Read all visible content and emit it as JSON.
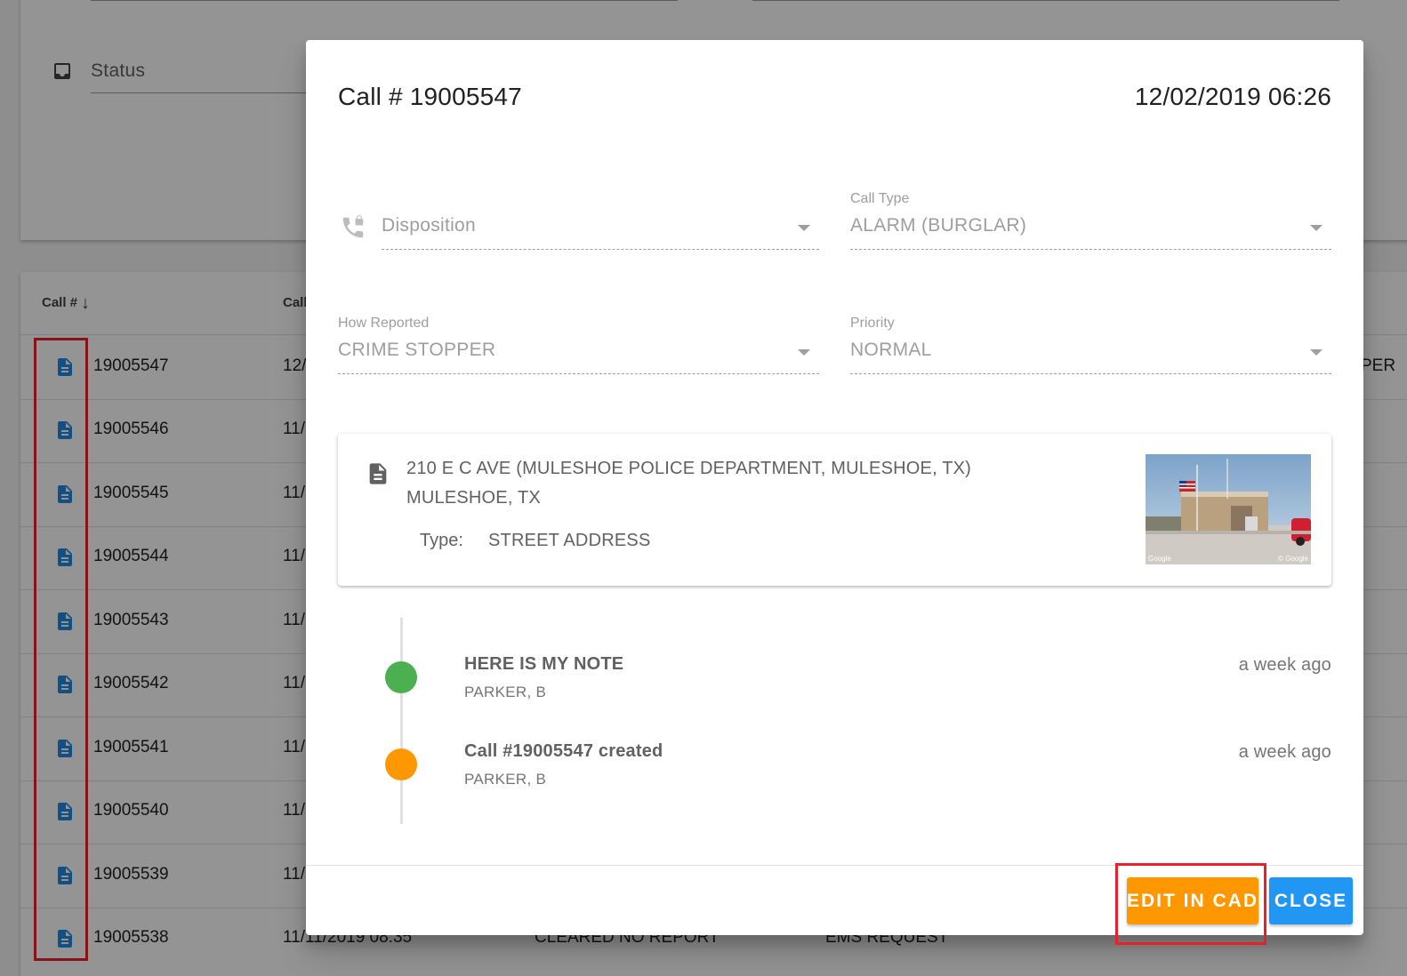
{
  "filters": {
    "status_label": "Status"
  },
  "table": {
    "headers": {
      "call_num": "Call #",
      "call_partial": "Call"
    },
    "sort_icon": "arrow-down-icon",
    "rows": [
      {
        "num": "19005547",
        "date": "12/",
        "disp": "",
        "type": "",
        "edge": "PER"
      },
      {
        "num": "19005546",
        "date": "11/",
        "disp": "",
        "type": "",
        "edge": ""
      },
      {
        "num": "19005545",
        "date": "11/",
        "disp": "",
        "type": "",
        "edge": ""
      },
      {
        "num": "19005544",
        "date": "11/",
        "disp": "",
        "type": "",
        "edge": ""
      },
      {
        "num": "19005543",
        "date": "11/",
        "disp": "",
        "type": "",
        "edge": ""
      },
      {
        "num": "19005542",
        "date": "11/",
        "disp": "",
        "type": "",
        "edge": ""
      },
      {
        "num": "19005541",
        "date": "11/",
        "disp": "",
        "type": "",
        "edge": ""
      },
      {
        "num": "19005540",
        "date": "11/",
        "disp": "",
        "type": "",
        "edge": ""
      },
      {
        "num": "19005539",
        "date": "11/",
        "disp": "",
        "type": "",
        "edge": ""
      },
      {
        "num": "19005538",
        "date": "11/11/2019 08:35",
        "disp": "CLEARED NO REPORT",
        "type": "EMS REQUEST",
        "edge": ""
      }
    ]
  },
  "dialog": {
    "title": "Call # 19005547",
    "datetime": "12/02/2019 06:26",
    "fields": {
      "disposition": {
        "caption": "",
        "placeholder": "Disposition",
        "value": ""
      },
      "call_type": {
        "caption": "Call Type",
        "value": "ALARM (BURGLAR)"
      },
      "how_reported": {
        "caption": "How Reported",
        "value": "CRIME STOPPER"
      },
      "priority": {
        "caption": "Priority",
        "value": "NORMAL"
      }
    },
    "address": {
      "line1": "210 E C AVE (MULESHOE POLICE DEPARTMENT, MULESHOE, TX)",
      "line2": "MULESHOE, TX",
      "type_label": "Type:",
      "type_value": "STREET ADDRESS",
      "photo_tags": {
        "left": "Google",
        "right": "© Google"
      }
    },
    "timeline": [
      {
        "title": "HERE IS MY NOTE",
        "author": "PARKER, B",
        "time": "a week ago",
        "color": "#4caf50"
      },
      {
        "title": "Call #19005547 created",
        "author": "PARKER, B",
        "time": "a week ago",
        "color": "#ff9800"
      }
    ],
    "buttons": {
      "edit": "EDIT IN CAD",
      "close": "CLOSE"
    }
  },
  "colors": {
    "accent_orange": "#ff9800",
    "accent_blue": "#2196f3",
    "doc_icon_blue": "#1e88e5",
    "highlight_red": "#e8202a"
  }
}
